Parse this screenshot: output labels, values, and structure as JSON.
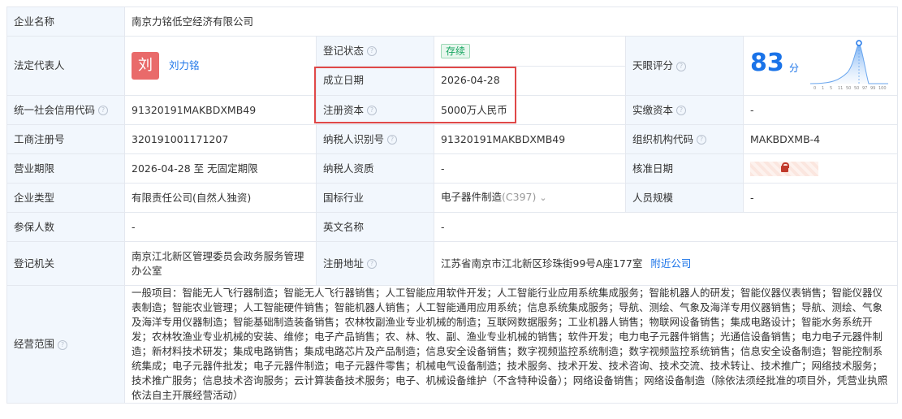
{
  "company_name": {
    "label": "企业名称",
    "value": "南京力铭低空经济有限公司"
  },
  "legal_rep": {
    "label": "法定代表人",
    "avatar_char": "刘",
    "name": "刘力铭"
  },
  "reg_status": {
    "label": "登记状态",
    "value": "存续"
  },
  "found_date": {
    "label": "成立日期",
    "value": "2026-04-28"
  },
  "reg_capital": {
    "label": "注册资本",
    "value": "5000万人民币"
  },
  "tianyan": {
    "label": "天眼评分",
    "score": "83",
    "unit": "分",
    "axis_ticks": [
      "0",
      "1",
      "5",
      "11",
      "50",
      "50",
      "97",
      "99",
      "100"
    ]
  },
  "credit_code": {
    "label": "统一社会信用代码",
    "value": "91320191MAKBDXMB49"
  },
  "paid_capital": {
    "label": "实缴资本",
    "value": "-"
  },
  "biz_reg_no": {
    "label": "工商注册号",
    "value": "320191001171207"
  },
  "taxpayer_id": {
    "label": "纳税人识别号",
    "value": "91320191MAKBDXMB49"
  },
  "org_code": {
    "label": "组织机构代码",
    "value": "MAKBDXMB-4"
  },
  "biz_term": {
    "label": "营业期限",
    "value": "2026-04-28 至 无固定期限"
  },
  "taxpayer_qual": {
    "label": "纳税人资质",
    "value": "-"
  },
  "approval_date": {
    "label": "核准日期"
  },
  "company_type": {
    "label": "企业类型",
    "value": "有限责任公司(自然人独资)"
  },
  "industry": {
    "label": "国标行业",
    "value": "电子器件制造",
    "code": "(C397)"
  },
  "staff_size": {
    "label": "人员规模",
    "value": "-"
  },
  "insured": {
    "label": "参保人数",
    "value": "-"
  },
  "english_name": {
    "label": "英文名称",
    "value": "-"
  },
  "reg_authority": {
    "label": "登记机关",
    "value": "南京江北新区管理委员会政务服务管理办公室"
  },
  "reg_address": {
    "label": "注册地址",
    "value": "江苏省南京市江北新区珍珠街99号A座177室",
    "nearby": "附近公司"
  },
  "biz_scope": {
    "label": "经营范围",
    "value": "一般项目：智能无人飞行器制造；智能无人飞行器销售；人工智能应用软件开发；人工智能行业应用系统集成服务；智能机器人的研发；智能仪器仪表销售；智能仪器仪表制造；智能农业管理；人工智能硬件销售；智能机器人销售；人工智能通用应用系统；信息系统集成服务；导航、测绘、气象及海洋专用仪器销售；导航、测绘、气象及海洋专用仪器制造；智能基础制造装备销售；农林牧副渔业专业机械的制造；互联网数据服务；工业机器人销售；物联网设备销售；集成电路设计；智能水务系统开发；农林牧渔业专业机械的安装、维修；电子产品销售；农、林、牧、副、渔业专业机械的销售；软件开发；电力电子元器件销售；光通信设备销售；电力电子元器件制造；新材料技术研发；集成电路销售；集成电路芯片及产品制造；信息安全设备销售；数字视频监控系统制造；数字视频监控系统销售；信息安全设备制造；智能控制系统集成；电子元器件批发；电子元器件制造；电子元器件零售；机械电气设备制造；技术服务、技术开发、技术咨询、技术交流、技术转让、技术推广；网络技术服务；技术推广服务；信息技术咨询服务；云计算装备技术服务；电子、机械设备维护（不含特种设备）；网络设备销售；网络设备制造（除依法须经批准的项目外，凭营业执照依法自主开展经营活动）"
  },
  "colors": {
    "label_bg": "#f2f7fd",
    "link": "#1a73e8",
    "badge_green": "#16a560",
    "highlight_red": "#e04848"
  }
}
